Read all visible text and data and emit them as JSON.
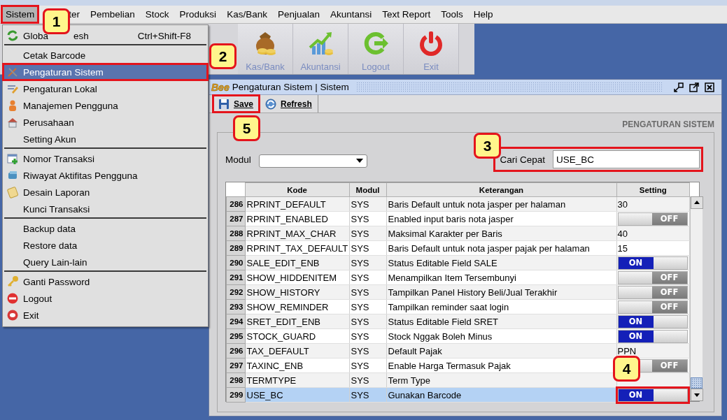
{
  "menubar": [
    {
      "label": "Sistem",
      "selected": true,
      "annotated": true
    },
    {
      "label": "ter",
      "selected": false,
      "annotated": false
    },
    {
      "label": "Pembelian",
      "selected": false,
      "annotated": false
    },
    {
      "label": "Stock",
      "selected": false,
      "annotated": false
    },
    {
      "label": "Produksi",
      "selected": false,
      "annotated": false
    },
    {
      "label": "Kas/Bank",
      "selected": false,
      "annotated": false
    },
    {
      "label": "Penjualan",
      "selected": false,
      "annotated": false
    },
    {
      "label": "Akuntansi",
      "selected": false,
      "annotated": false
    },
    {
      "label": "Text Report",
      "selected": false,
      "annotated": false
    },
    {
      "label": "Tools",
      "selected": false,
      "annotated": false
    },
    {
      "label": "Help",
      "selected": false,
      "annotated": false
    }
  ],
  "toolbar": [
    {
      "label": "Kas/Bank"
    },
    {
      "label": "Akuntansi"
    },
    {
      "label": "Logout"
    },
    {
      "label": "Exit"
    }
  ],
  "menu": {
    "sections": [
      [
        {
          "label": "Globa",
          "label_tail": "esh",
          "shortcut": "Ctrl+Shift-F8",
          "selected": false,
          "annotated": false
        }
      ],
      [
        {
          "label": "Cetak Barcode",
          "selected": false,
          "annotated": false
        },
        {
          "label": "Pengaturan Sistem",
          "selected": true,
          "annotated": true
        },
        {
          "label": "Pengaturan Lokal",
          "selected": false,
          "annotated": false
        },
        {
          "label": "Manajemen Pengguna",
          "selected": false,
          "annotated": false
        },
        {
          "label": "Perusahaan",
          "selected": false,
          "annotated": false
        },
        {
          "label": "Setting Akun",
          "selected": false,
          "annotated": false
        }
      ],
      [
        {
          "label": "Nomor Transaksi",
          "selected": false,
          "annotated": false
        },
        {
          "label": "Riwayat Aktifitas Pengguna",
          "selected": false,
          "annotated": false
        },
        {
          "label": "Desain Laporan",
          "selected": false,
          "annotated": false
        },
        {
          "label": "Kunci Transaksi",
          "selected": false,
          "annotated": false
        }
      ],
      [
        {
          "label": "Backup data",
          "selected": false,
          "annotated": false
        },
        {
          "label": "Restore data",
          "selected": false,
          "annotated": false
        },
        {
          "label": "Query Lain-lain",
          "selected": false,
          "annotated": false
        }
      ],
      [
        {
          "label": "Ganti Password",
          "selected": false,
          "annotated": false
        },
        {
          "label": "Logout",
          "selected": false,
          "annotated": false
        },
        {
          "label": "Exit",
          "selected": false,
          "annotated": false
        }
      ]
    ]
  },
  "window": {
    "logo": "Bee",
    "title": "Pengaturan Sistem | Sistem",
    "buttons": [
      {
        "label": "Save",
        "annotated": true
      },
      {
        "label": "Refresh",
        "annotated": false
      }
    ],
    "heading": "PENGATURAN SISTEM",
    "modul": {
      "label": "Modul"
    },
    "search": {
      "label": "Cari Cepat",
      "value": "USE_BC",
      "annotated": true
    },
    "table": {
      "columns": [
        "Kode",
        "Modul",
        "Keterangan",
        "Setting"
      ],
      "rows": [
        {
          "no": "286",
          "kode": "RPRINT_DEFAULT",
          "modul": "SYS",
          "keterangan": "Baris Default untuk nota jasper per halaman",
          "selected": false,
          "setting": {
            "kind": "text",
            "value": "30"
          }
        },
        {
          "no": "287",
          "kode": "RPRINT_ENABLED",
          "modul": "SYS",
          "keterangan": "Enabled input baris nota jasper",
          "selected": false,
          "setting": {
            "kind": "toggle",
            "on": false,
            "label": "OFF"
          }
        },
        {
          "no": "288",
          "kode": "RPRINT_MAX_CHAR",
          "modul": "SYS",
          "keterangan": "Maksimal Karakter per Baris",
          "selected": false,
          "setting": {
            "kind": "text",
            "value": "40"
          }
        },
        {
          "no": "289",
          "kode": "RPRINT_TAX_DEFAULT",
          "modul": "SYS",
          "keterangan": "Baris Default untuk nota jasper pajak per halaman",
          "selected": false,
          "setting": {
            "kind": "text",
            "value": "15"
          }
        },
        {
          "no": "290",
          "kode": "SALE_EDIT_ENB",
          "modul": "SYS",
          "keterangan": "Status Editable Field SALE",
          "selected": false,
          "setting": {
            "kind": "toggle",
            "on": true,
            "label": "ON"
          }
        },
        {
          "no": "291",
          "kode": "SHOW_HIDDENITEM",
          "modul": "SYS",
          "keterangan": "Menampilkan Item Tersembunyi",
          "selected": false,
          "setting": {
            "kind": "toggle",
            "on": false,
            "label": "OFF"
          }
        },
        {
          "no": "292",
          "kode": "SHOW_HISTORY",
          "modul": "SYS",
          "keterangan": "Tampilkan Panel History Beli/Jual Terakhir",
          "selected": false,
          "setting": {
            "kind": "toggle",
            "on": false,
            "label": "OFF"
          }
        },
        {
          "no": "293",
          "kode": "SHOW_REMINDER",
          "modul": "SYS",
          "keterangan": "Tampilkan reminder saat login",
          "selected": false,
          "setting": {
            "kind": "toggle",
            "on": false,
            "label": "OFF"
          }
        },
        {
          "no": "294",
          "kode": "SRET_EDIT_ENB",
          "modul": "SYS",
          "keterangan": "Status Editable Field SRET",
          "selected": false,
          "setting": {
            "kind": "toggle",
            "on": true,
            "label": "ON"
          }
        },
        {
          "no": "295",
          "kode": "STOCK_GUARD",
          "modul": "SYS",
          "keterangan": "Stock Nggak Boleh Minus",
          "selected": false,
          "setting": {
            "kind": "toggle",
            "on": true,
            "label": "ON"
          }
        },
        {
          "no": "296",
          "kode": "TAX_DEFAULT",
          "modul": "SYS",
          "keterangan": "Default Pajak",
          "selected": false,
          "setting": {
            "kind": "text",
            "value": "PPN"
          }
        },
        {
          "no": "297",
          "kode": "TAXINC_ENB",
          "modul": "SYS",
          "keterangan": "Enable Harga Termasuk Pajak",
          "selected": false,
          "setting": {
            "kind": "toggle",
            "on": false,
            "label": "OFF"
          }
        },
        {
          "no": "298",
          "kode": "TERMTYPE",
          "modul": "SYS",
          "keterangan": "Term Type",
          "selected": false
        },
        {
          "no": "299",
          "kode": "USE_BC",
          "modul": "SYS",
          "keterangan": "Gunakan Barcode",
          "selected": true,
          "setting": {
            "kind": "toggle",
            "on": true,
            "label": "ON",
            "annotated": true
          }
        }
      ]
    }
  },
  "callouts": [
    {
      "label": "1"
    },
    {
      "label": "2"
    },
    {
      "label": "3"
    },
    {
      "label": "4"
    },
    {
      "label": "5"
    }
  ]
}
